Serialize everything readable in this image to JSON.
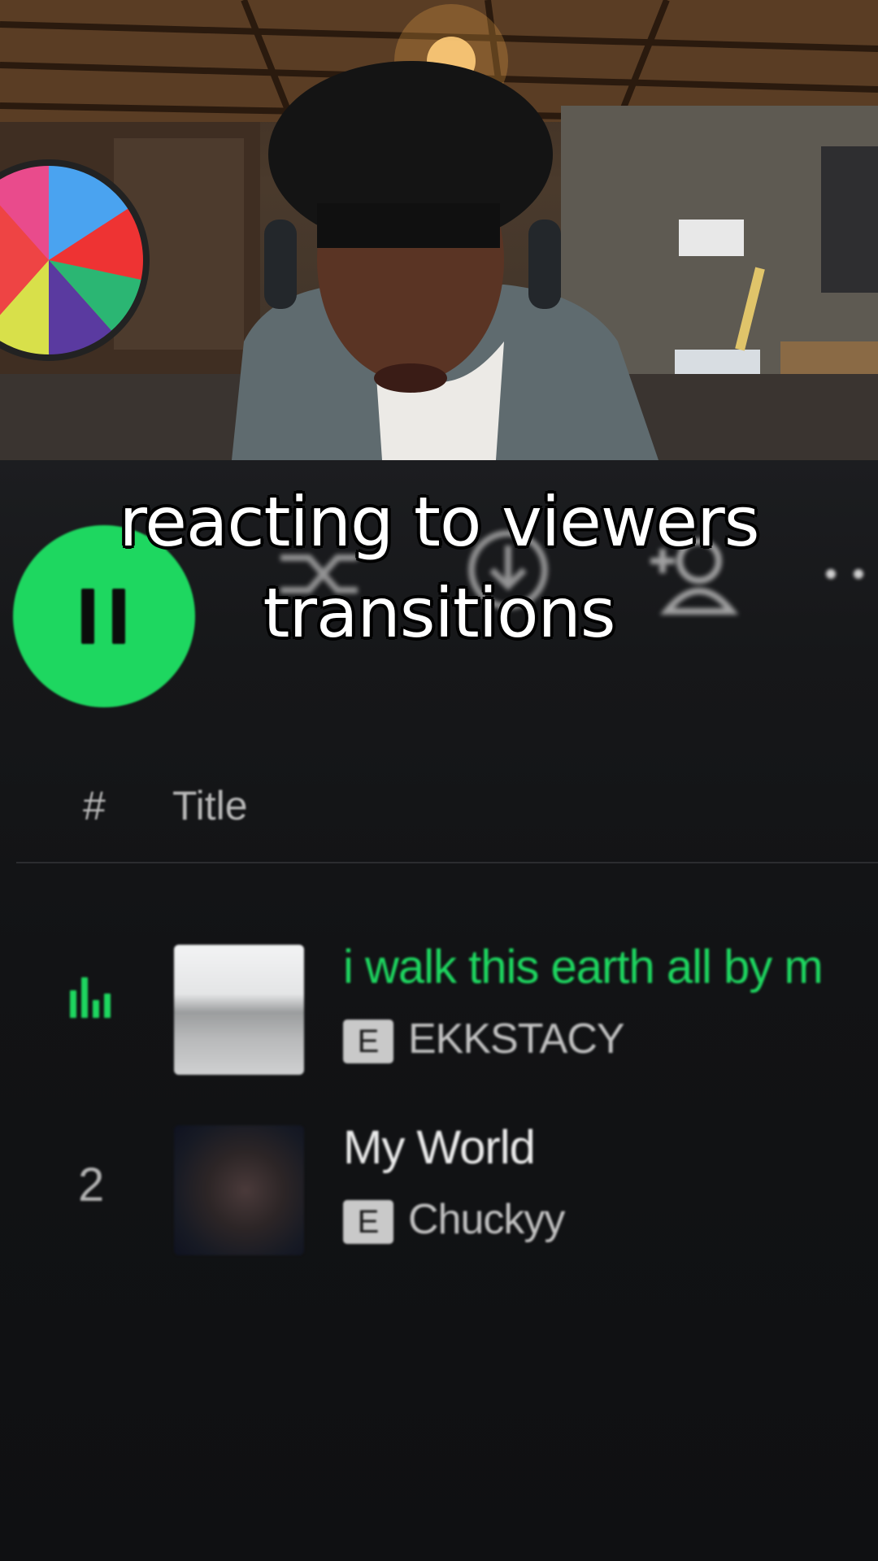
{
  "caption": {
    "line1": "reacting to viewers",
    "line2": "transitions"
  },
  "player": {
    "play_state": "playing",
    "table_header": {
      "number_col": "#",
      "title_col": "Title"
    },
    "tracks": [
      {
        "indicator": "now-playing-equalizer",
        "title": "i walk this earth all by m",
        "explicit_badge": "E",
        "artist": "EKKSTACY",
        "is_playing": true
      },
      {
        "number": "2",
        "title": "My World",
        "explicit_badge": "E",
        "artist": "Chuckyy",
        "is_playing": false
      }
    ]
  },
  "colors": {
    "accent": "#1ed760",
    "background": "#121315",
    "text_primary": "#ececec",
    "text_secondary": "#b3b3b3"
  },
  "icons": [
    "pause-icon",
    "shuffle-icon",
    "download-icon",
    "add-user-icon",
    "more-options-icon",
    "equalizer-icon"
  ]
}
